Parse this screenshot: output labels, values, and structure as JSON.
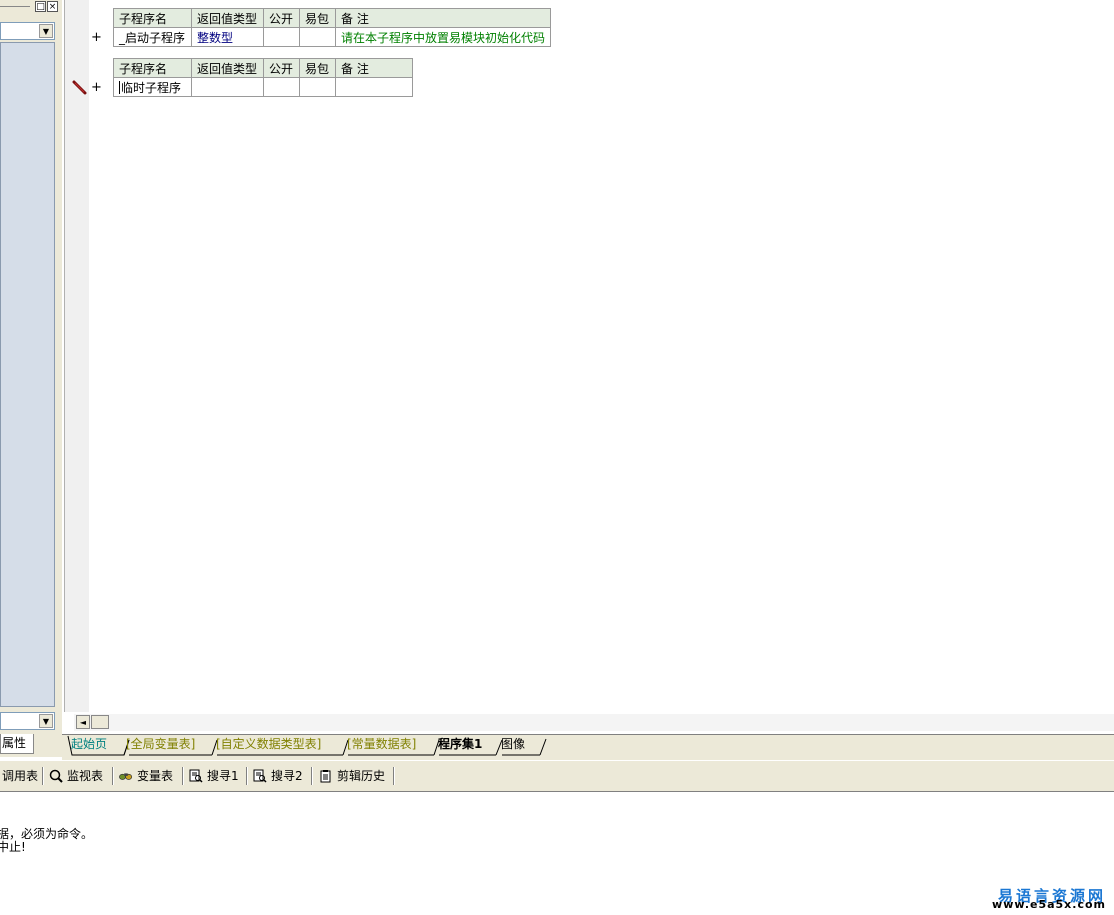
{
  "left_panel": {
    "tab_label": "属性",
    "restore_glyph": "□",
    "close_glyph": "×",
    "dropdown_glyph": "▼"
  },
  "editor": {
    "subroutine_tables": [
      {
        "headers": [
          "子程序名",
          "返回值类型",
          "公开",
          "易包",
          "备 注"
        ],
        "row": {
          "name": "_启动子程序",
          "return_type": "整数型",
          "public": "",
          "easy_pkg": "",
          "note": "请在本子程序中放置易模块初始化代码"
        },
        "expand_glyph": "+"
      },
      {
        "headers": [
          "子程序名",
          "返回值类型",
          "公开",
          "易包",
          "备 注"
        ],
        "row": {
          "name": "临时子程序",
          "return_type": "",
          "public": "",
          "easy_pkg": "",
          "note": ""
        },
        "expand_glyph": "+"
      }
    ],
    "scroll_left_glyph": "◄"
  },
  "doc_tabs": [
    {
      "label": "起始页"
    },
    {
      "label": "[全局变量表]"
    },
    {
      "label": "[自定义数据类型表]"
    },
    {
      "label": "[常量数据表]"
    },
    {
      "label": "程序集1"
    },
    {
      "label": "图像"
    }
  ],
  "tool_tabs": [
    {
      "label": "调用表",
      "icon": "list-icon"
    },
    {
      "label": "监视表",
      "icon": "magnifier-icon"
    },
    {
      "label": "变量表",
      "icon": "variables-icon"
    },
    {
      "label": "搜寻1",
      "icon": "search-doc-icon"
    },
    {
      "label": "搜寻2",
      "icon": "search-doc-icon"
    },
    {
      "label": "剪辑历史",
      "icon": "clipboard-icon"
    }
  ],
  "output": {
    "lines": [
      "据，必须为命令。",
      "中止!"
    ]
  },
  "watermark": {
    "name": "易语言资源网",
    "url": "www.e5a5x.com"
  },
  "colors": {
    "header_bg": "#e3ecdf",
    "type_blue": "#000080",
    "note_green": "#008000",
    "watermark_blue": "#1b77d3"
  }
}
